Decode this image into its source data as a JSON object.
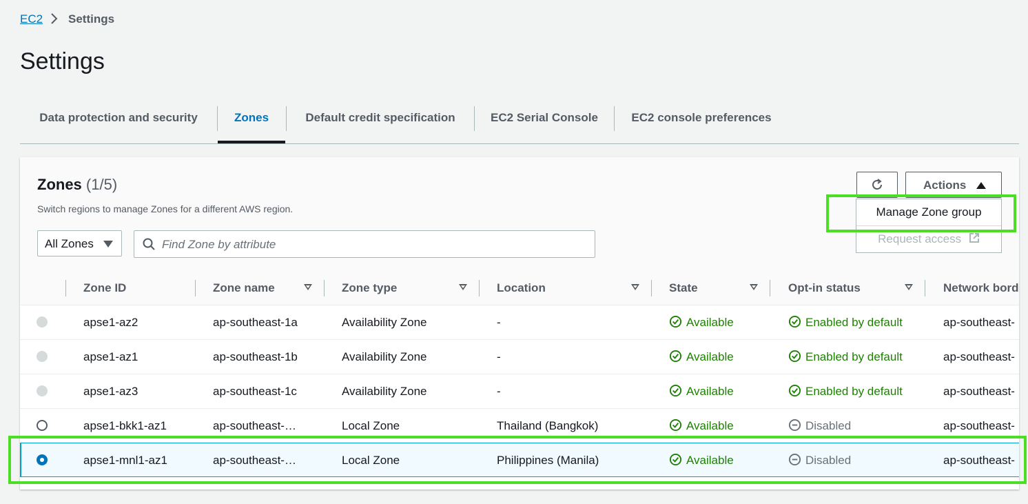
{
  "breadcrumb": {
    "parent": "EC2",
    "separator": ">",
    "current": "Settings"
  },
  "page": {
    "title": "Settings"
  },
  "tabs": [
    {
      "label": "Data protection and security",
      "active": false
    },
    {
      "label": "Zones",
      "active": true
    },
    {
      "label": "Default credit specification",
      "active": false
    },
    {
      "label": "EC2 Serial Console",
      "active": false
    },
    {
      "label": "EC2 console preferences",
      "active": false
    }
  ],
  "zones_panel": {
    "title": "Zones",
    "count": "(1/5)",
    "description": "Switch regions to manage Zones for a different AWS region.",
    "filter_select": "All Zones",
    "search_placeholder": "Find Zone by attribute",
    "actions_label": "Actions",
    "actions_menu": [
      "Manage Zone group",
      "Request access"
    ]
  },
  "table": {
    "columns": [
      "Zone ID",
      "Zone name",
      "Zone type",
      "Location",
      "State",
      "Opt-in status",
      "Network bord"
    ],
    "rows": [
      {
        "radio": "disabled",
        "zone_id": "apse1-az2",
        "zone_name": "ap-southeast-1a",
        "zone_type": "Availability Zone",
        "location": "-",
        "state": "Available",
        "opt_in": "Enabled by default",
        "network": "ap-southeast-"
      },
      {
        "radio": "disabled",
        "zone_id": "apse1-az1",
        "zone_name": "ap-southeast-1b",
        "zone_type": "Availability Zone",
        "location": "-",
        "state": "Available",
        "opt_in": "Enabled by default",
        "network": "ap-southeast-"
      },
      {
        "radio": "disabled",
        "zone_id": "apse1-az3",
        "zone_name": "ap-southeast-1c",
        "zone_type": "Availability Zone",
        "location": "-",
        "state": "Available",
        "opt_in": "Enabled by default",
        "network": "ap-southeast-"
      },
      {
        "radio": "unselected",
        "zone_id": "apse1-bkk1-az1",
        "zone_name": "ap-southeast-…",
        "zone_type": "Local Zone",
        "location": "Thailand (Bangkok)",
        "state": "Available",
        "opt_in": "Disabled",
        "network": "ap-southeast-"
      },
      {
        "radio": "selected",
        "zone_id": "apse1-mnl1-az1",
        "zone_name": "ap-southeast-…",
        "zone_type": "Local Zone",
        "location": "Philippines (Manila)",
        "state": "Available",
        "opt_in": "Disabled",
        "network": "ap-southeast-"
      }
    ]
  },
  "colors": {
    "link": "#0073bb",
    "success": "#1d8102",
    "highlight": "#4cde25",
    "selected_row": "#f1faff"
  },
  "icons": [
    "chevron-right-icon",
    "search-icon",
    "refresh-icon",
    "caret-up-icon",
    "external-link-icon",
    "check-circle-icon",
    "minus-circle-icon",
    "sort-caret-icon"
  ]
}
